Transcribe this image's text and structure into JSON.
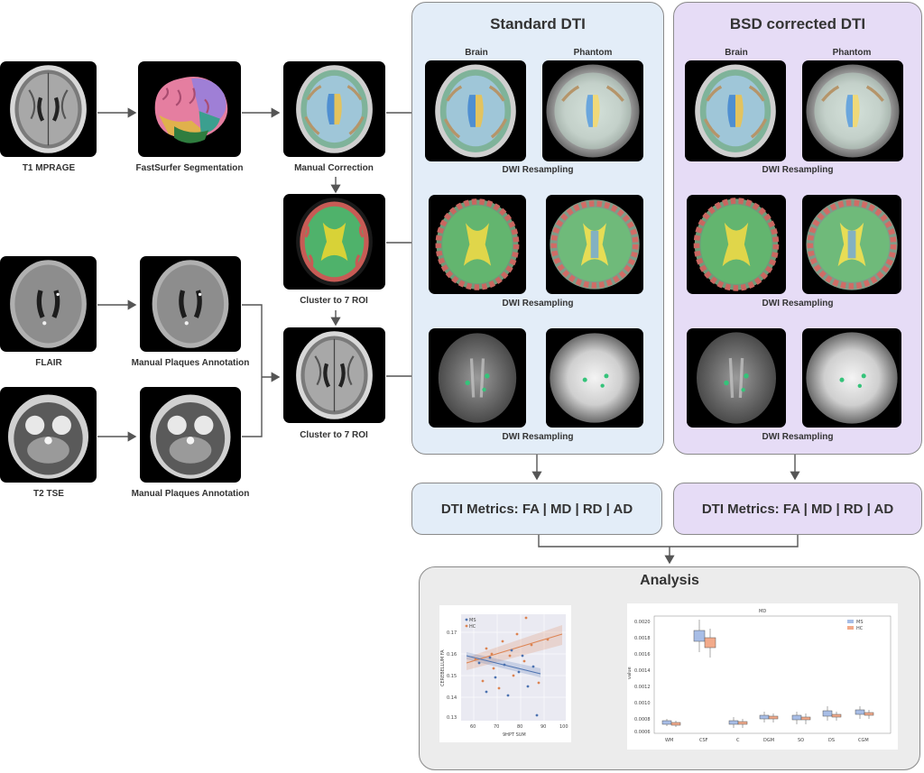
{
  "inputs": {
    "t1": "T1 MPRAGE",
    "flair": "FLAIR",
    "t2": "T2 TSE"
  },
  "steps": {
    "fastsurfer": "FastSurfer Segmentation",
    "manual_correction": "Manual Correction",
    "cluster_1": "Cluster to 7 ROI",
    "cluster_2": "Cluster to 7 ROI",
    "plaques_1": "Manual Plaques Annotation",
    "plaques_2": "Manual Plaques Annotation"
  },
  "standard": {
    "title": "Standard DTI",
    "brain": "Brain",
    "phantom": "Phantom",
    "resampling_1": "DWI Resampling",
    "resampling_2": "DWI Resampling",
    "resampling_3": "DWI Resampling",
    "metrics": "DTI Metrics: FA | MD | RD | AD"
  },
  "bsd": {
    "title": "BSD corrected DTI",
    "brain": "Brain",
    "phantom": "Phantom",
    "resampling_1": "DWI Resampling",
    "resampling_2": "DWI Resampling",
    "resampling_3": "DWI Resampling",
    "metrics": "DTI Metrics: FA | MD | RD | AD"
  },
  "analysis": {
    "title": "Analysis",
    "scatter": {
      "xlabel": "9HPT SUM",
      "ylabel": "CEREBELLUM FA",
      "legend": [
        "MS",
        "HC"
      ],
      "xticks": [
        "60",
        "70",
        "80",
        "90",
        "100"
      ],
      "yticks": [
        "0.17",
        "0.16",
        "0.15",
        "0.14",
        "0.13"
      ]
    },
    "box": {
      "title": "MD",
      "ylabel": "value",
      "legend": [
        "MS",
        "HC"
      ],
      "categories": [
        "WM",
        "CSF",
        "C",
        "DGM",
        "SO",
        "DS",
        "CGM"
      ],
      "yticks": [
        "0.0020",
        "0.0018",
        "0.0016",
        "0.0014",
        "0.0012",
        "0.0010",
        "0.0008",
        "0.0006"
      ]
    }
  },
  "colors": {
    "standard_panel": "#e3edf8",
    "bsd_panel": "#e6dcf6",
    "analysis_panel": "#ececec",
    "ms_series": "#4c72b0",
    "hc_series": "#dd8452"
  }
}
